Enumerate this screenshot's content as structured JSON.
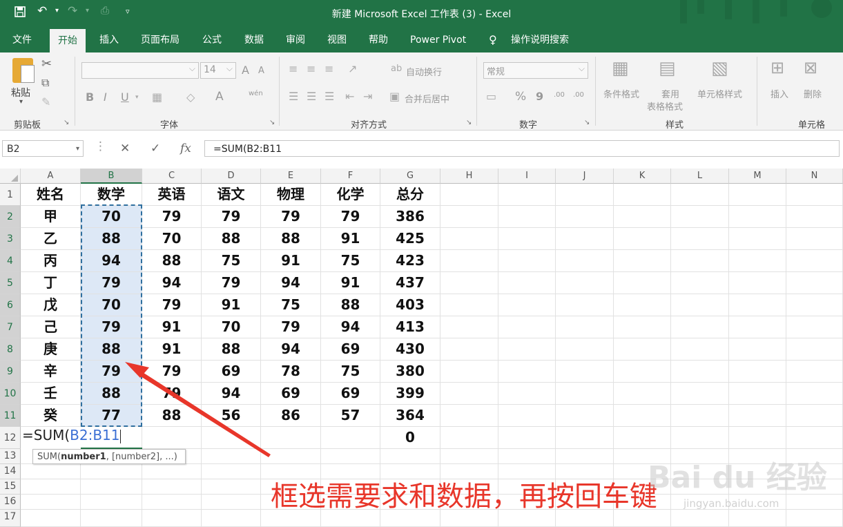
{
  "title_bar": {
    "title": "新建 Microsoft Excel 工作表 (3)  -  Excel",
    "save_icon": "save-icon",
    "undo_icon": "undo-icon",
    "redo_icon": "redo-icon",
    "quick_access_more_icon": "chevron-down-icon"
  },
  "tabs": [
    "文件",
    "开始",
    "插入",
    "页面布局",
    "公式",
    "数据",
    "审阅",
    "视图",
    "帮助",
    "Power Pivot"
  ],
  "active_tab": "开始",
  "tell_me": "操作说明搜索",
  "ribbon": {
    "clipboard": {
      "paste_label": "粘贴",
      "group_label": "剪贴板"
    },
    "font": {
      "font_size": "14",
      "group_label": "字体",
      "bold": "B",
      "italic": "I",
      "underline": "U",
      "grow": "A",
      "shrink": "A",
      "font_color": "A",
      "phonetic": "wén"
    },
    "alignment": {
      "wrap_text": "自动换行",
      "merge_center": "合并后居中",
      "group_label": "对齐方式"
    },
    "number": {
      "format": "常规",
      "percent": "%",
      "comma": "9",
      "inc_decimal": ".00",
      "group_label": "数字"
    },
    "styles": {
      "conditional": "条件格式",
      "table_format_1": "套用",
      "table_format_2": "表格格式",
      "cell_styles": "单元格样式",
      "group_label": "样式"
    },
    "cells": {
      "insert": "插入",
      "delete": "删除",
      "group_label": "单元格"
    }
  },
  "formula_bar": {
    "name_box": "B2",
    "cancel": "✕",
    "enter": "✓",
    "fx": "fx",
    "formula": "=SUM(B2:B11"
  },
  "columns": [
    "A",
    "B",
    "C",
    "D",
    "E",
    "F",
    "G",
    "H",
    "I",
    "J",
    "K",
    "L",
    "M",
    "N"
  ],
  "rows": [
    "1",
    "2",
    "3",
    "4",
    "5",
    "6",
    "7",
    "8",
    "9",
    "10",
    "11",
    "12",
    "13",
    "14",
    "15",
    "16",
    "17"
  ],
  "table": {
    "headers": [
      "姓名",
      "数学",
      "英语",
      "语文",
      "物理",
      "化学",
      "总分"
    ],
    "rows": [
      [
        "甲",
        "70",
        "79",
        "79",
        "79",
        "79",
        "386"
      ],
      [
        "乙",
        "88",
        "70",
        "88",
        "88",
        "91",
        "425"
      ],
      [
        "丙",
        "94",
        "88",
        "75",
        "91",
        "75",
        "423"
      ],
      [
        "丁",
        "79",
        "94",
        "79",
        "94",
        "91",
        "437"
      ],
      [
        "戊",
        "70",
        "79",
        "91",
        "75",
        "88",
        "403"
      ],
      [
        "己",
        "79",
        "91",
        "70",
        "79",
        "94",
        "413"
      ],
      [
        "庚",
        "88",
        "91",
        "88",
        "94",
        "69",
        "430"
      ],
      [
        "辛",
        "79",
        "79",
        "69",
        "78",
        "75",
        "380"
      ],
      [
        "壬",
        "88",
        "79",
        "94",
        "69",
        "69",
        "399"
      ],
      [
        "癸",
        "77",
        "88",
        "56",
        "86",
        "57",
        "364"
      ]
    ],
    "row12_g": "0"
  },
  "edit_cell": {
    "prefix": "=SUM(",
    "ref": "B2:B11"
  },
  "tooltip": {
    "fn": "SUM(",
    "arg1": "number1",
    "rest": ", [number2], ...)"
  },
  "annotation": "框选需要求和数据，再按回车键",
  "watermark": {
    "brand": "Bai du 经验",
    "url": "jingyan.baidu.com"
  },
  "colors": {
    "excel_green": "#217346",
    "annotation_red": "#e8362a",
    "selection_fill": "#dde8f6"
  }
}
